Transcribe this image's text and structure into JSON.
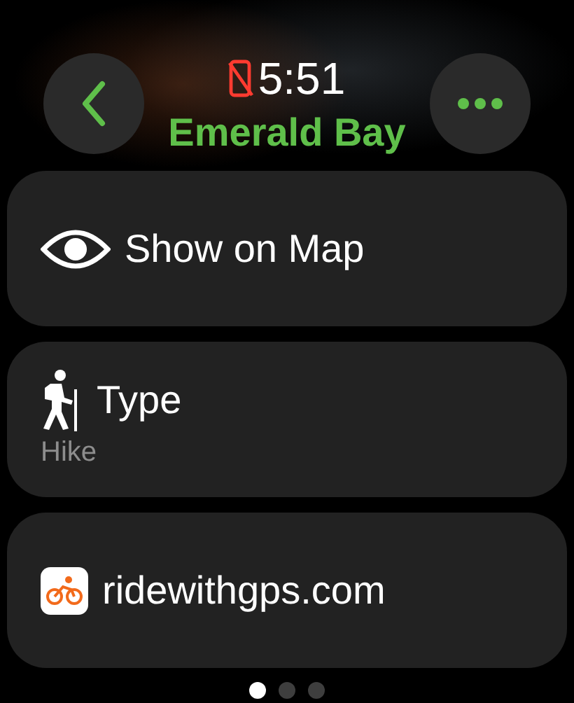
{
  "status": {
    "phone_disconnected": true,
    "time": "5:51"
  },
  "title": "Emerald Bay",
  "cards": [
    {
      "kind": "map",
      "label": "Show on Map"
    },
    {
      "kind": "type",
      "label": "Type",
      "value": "Hike"
    },
    {
      "kind": "link",
      "label": "ridewithgps.com"
    }
  ],
  "pages": [
    {
      "selected": true
    },
    {
      "selected": false
    },
    {
      "selected": false
    }
  ]
}
